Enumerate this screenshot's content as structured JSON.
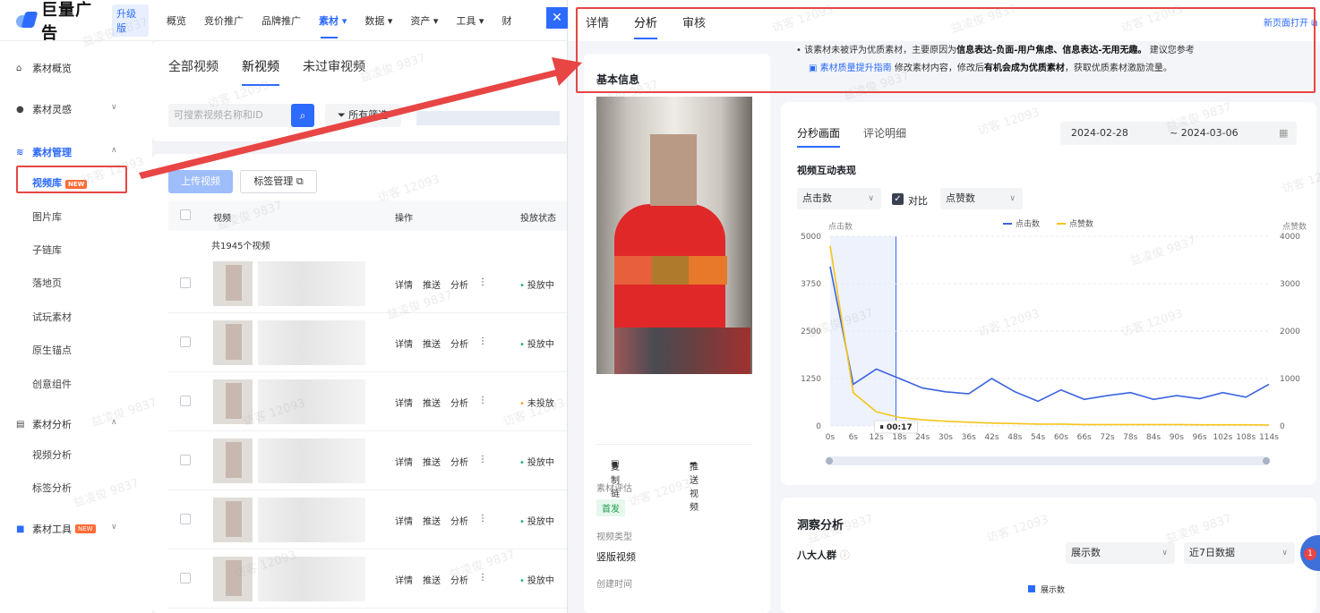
{
  "brand": {
    "logo_text": "巨量广告",
    "edition": "升级版"
  },
  "topnav": [
    "概览",
    "竞价推广",
    "品牌推广",
    "素材 ▾",
    "数据 ▾",
    "资产 ▾",
    "工具 ▾",
    "财"
  ],
  "topnav_active_index": 3,
  "close_label": "✕",
  "sidebar": {
    "overview": "素材概览",
    "inspiration": "素材灵感",
    "management": "素材管理",
    "sub": [
      "视频库",
      "图片库",
      "子链库",
      "落地页",
      "试玩素材",
      "原生锚点",
      "创意组件"
    ],
    "new_badge": "NEW",
    "analysis": "素材分析",
    "analysis_sub": [
      "视频分析",
      "标签分析"
    ],
    "tools": "素材工具",
    "tools_badge": "NEW"
  },
  "main": {
    "tabs": [
      "全部视频",
      "新视频",
      "未过审视频"
    ],
    "search_placeholder": "可搜索视频名称和ID",
    "filter_label": "所有筛选",
    "upload_label": "上传视频",
    "tag_label": "标签管理",
    "columns": [
      "视频",
      "操作",
      "投放状态"
    ],
    "total": "共1945个视频",
    "row_ops": [
      "详情",
      "推送",
      "分析",
      "⋮"
    ],
    "rows": [
      {
        "status": "投放中",
        "active": true
      },
      {
        "status": "投放中",
        "active": true
      },
      {
        "status": "未投放",
        "active": false
      },
      {
        "status": "投放中",
        "active": true
      },
      {
        "status": "投放中",
        "active": true
      },
      {
        "status": "投放中",
        "active": true
      }
    ]
  },
  "overlay": {
    "tabs": [
      "详情",
      "分析",
      "审核"
    ],
    "active_tab": 1,
    "new_page": "新页面打开",
    "notice_prefix": "该素材未被评为优质素材，主要原因为",
    "notice_reasons": "信息表达-负面-用户焦虑、信息表达-无用无趣。",
    "notice_suffix": "建议您参考",
    "guide_link": "素材质量提升指南",
    "guide_text_1": "修改素材内容，修改后",
    "guide_bold": "有机会成为优质素材",
    "guide_text_2": "，获取优质素材激励流量。",
    "basic_info": "基本信息",
    "copy_link": "复制链接",
    "push_video": "推送视频",
    "eval_label": "素材评估",
    "eval_tag": "首发",
    "type_label": "视频类型",
    "type_value": "竖版视频",
    "created_label": "创建时间"
  },
  "analysis": {
    "tabs": [
      "分秒画面",
      "评论明细"
    ],
    "date_start": "2024-02-28",
    "date_end": "~ 2024-03-06",
    "subtitle": "视频互动表现",
    "metric_select": "点击数",
    "compare_label": "对比",
    "compare_select": "点赞数",
    "insight_title": "洞察分析",
    "crowd_label": "八大人群",
    "crowd_metric": "展示数",
    "crowd_range": "近7日数据",
    "crowd_legend": "展示数"
  },
  "chart_data": {
    "type": "line",
    "ylabel_left": "点击数",
    "ylabel_right": "点赞数",
    "x": [
      "0s",
      "6s",
      "12s",
      "18s",
      "24s",
      "30s",
      "36s",
      "42s",
      "48s",
      "54s",
      "60s",
      "66s",
      "72s",
      "78s",
      "84s",
      "90s",
      "96s",
      "102s",
      "108s",
      "114s"
    ],
    "left_ticks": [
      0,
      1250,
      2500,
      3750,
      5000
    ],
    "right_ticks": [
      0,
      1000,
      2000,
      3000,
      4000
    ],
    "ylim_left": [
      0,
      5000
    ],
    "ylim_right": [
      0,
      4000
    ],
    "marker_label": "00:17",
    "series": [
      {
        "name": "点击数",
        "color": "#3b63e0",
        "axis": "left",
        "values": [
          4200,
          1100,
          1500,
          1250,
          1000,
          900,
          850,
          1250,
          900,
          650,
          950,
          700,
          800,
          880,
          700,
          800,
          720,
          880,
          760,
          1100
        ]
      },
      {
        "name": "点赞数",
        "color": "#f5c518",
        "axis": "right",
        "values": [
          3800,
          700,
          300,
          180,
          130,
          100,
          80,
          60,
          50,
          40,
          40,
          30,
          30,
          30,
          30,
          30,
          25,
          25,
          25,
          20
        ]
      }
    ]
  },
  "colors": {
    "accent": "#2d6bff",
    "highlight": "#e84545"
  },
  "watermark": [
    "益凌俊 9837",
    "访客 12093"
  ]
}
